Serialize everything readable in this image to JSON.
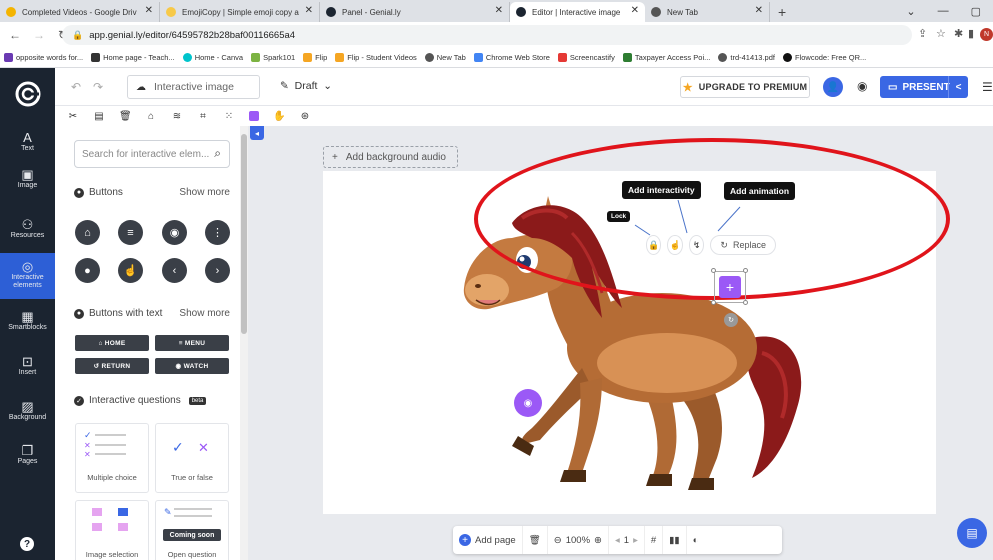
{
  "browser": {
    "tabs": [
      {
        "label": "Completed Videos - Google Driv",
        "color": "#f4b400"
      },
      {
        "label": "EmojiCopy | Simple emoji copy a",
        "color": "#f7c948"
      },
      {
        "label": "Panel - Genial.ly",
        "color": "#1b2430"
      },
      {
        "label": "Editor | Interactive image",
        "color": "#1b2430"
      },
      {
        "label": "New Tab",
        "color": "#555555"
      }
    ],
    "url": "app.genial.ly/editor/64595782b28baf00116665a4",
    "bookmarks": [
      {
        "label": "opposite words for...",
        "color": "#6a3ab2"
      },
      {
        "label": "Home page - Teach...",
        "color": "#333333"
      },
      {
        "label": "Home - Canva",
        "color": "#00c4cc"
      },
      {
        "label": "Spark101",
        "color": "#7cb342"
      },
      {
        "label": "Flip",
        "color": "#f5a623"
      },
      {
        "label": "Flip - Student Videos",
        "color": "#f5a623"
      },
      {
        "label": "New Tab",
        "color": "#555555"
      },
      {
        "label": "Chrome Web Store",
        "color": "#4285f4"
      },
      {
        "label": "Screencastify",
        "color": "#e53935"
      },
      {
        "label": "Taxpayer Access Poi...",
        "color": "#2e7d32"
      },
      {
        "label": "trd-41413.pdf",
        "color": "#555555"
      },
      {
        "label": "Flowcode: Free QR...",
        "color": "#111111"
      }
    ],
    "avatar_letter": "N"
  },
  "header": {
    "title_placeholder": "Interactive image",
    "status": "Draft",
    "upgrade_label": "UPGRADE TO PREMIUM",
    "present_label": "PRESENT"
  },
  "nav": [
    {
      "label": "Text",
      "icon": "A"
    },
    {
      "label": "Image",
      "icon": "▣"
    },
    {
      "label": "Resources",
      "icon": "⚇"
    },
    {
      "label": "Interactive elements",
      "icon": "◎"
    },
    {
      "label": "Smartblocks",
      "icon": "▦"
    },
    {
      "label": "Insert",
      "icon": "⊡"
    },
    {
      "label": "Background",
      "icon": "▨"
    },
    {
      "label": "Pages",
      "icon": "❐"
    }
  ],
  "panel": {
    "search_placeholder": "Search for interactive elem...",
    "buttons_title": "Buttons",
    "buttons_more": "Show more",
    "text_buttons_title": "Buttons with text",
    "text_buttons_more": "Show more",
    "text_buttons": [
      "⌂ HOME",
      "≡ MENU",
      "↺ RETURN",
      "◉ WATCH"
    ],
    "questions_title": "Interactive questions",
    "questions_badge": "beta",
    "cards": [
      "Multiple choice",
      "True or false",
      "Image selection",
      "Open question"
    ],
    "coming_soon": "Coming soon"
  },
  "canvas": {
    "audio_label": "Add background audio",
    "tip_interactivity": "Add interactivity",
    "tip_animation": "Add animation",
    "tip_lock": "Lock",
    "replace_label": "Replace"
  },
  "bottom": {
    "add_page": "Add page",
    "zoom": "100%",
    "page_number": "1"
  },
  "colors": {
    "sidebar": "#1b2430",
    "accent": "#3a67e4",
    "purple": "#9b59f6",
    "annotation": "#e0141b"
  }
}
